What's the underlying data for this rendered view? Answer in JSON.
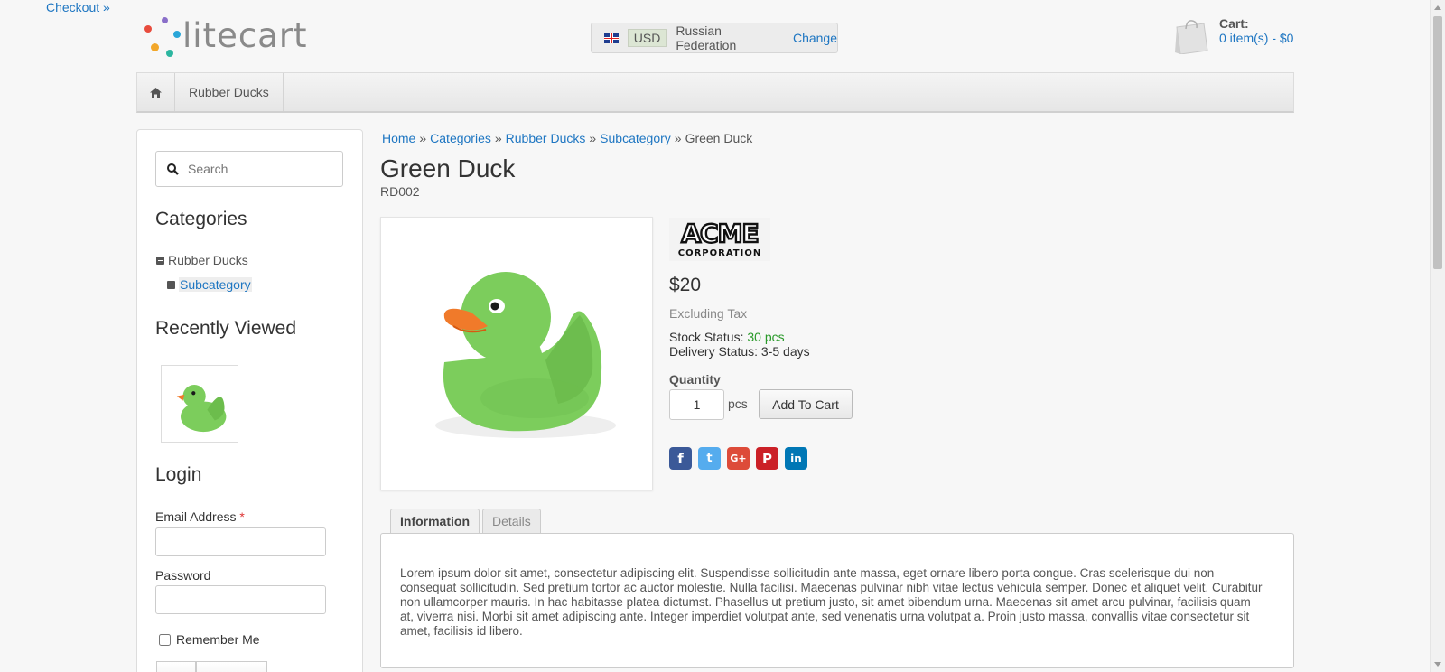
{
  "header": {
    "logo_text": "litecart",
    "region": {
      "currency": "USD",
      "country": "Russian Federation",
      "change_label": "Change"
    },
    "cart": {
      "label": "Cart:",
      "summary": "0 item(s) - $0",
      "checkout_label": "Checkout »"
    }
  },
  "navbar": {
    "home_icon": "home-icon",
    "items": [
      "Rubber Ducks"
    ]
  },
  "sidebar": {
    "search_placeholder": "Search",
    "categories_heading": "Categories",
    "categories": [
      {
        "label": "Rubber Ducks"
      },
      {
        "label": "Subcategory"
      }
    ],
    "recently_viewed_heading": "Recently Viewed",
    "login": {
      "heading": "Login",
      "email_label": "Email Address",
      "required_mark": "*",
      "password_label": "Password",
      "remember_label": "Remember Me"
    }
  },
  "breadcrumb": {
    "items": [
      "Home",
      "Categories",
      "Rubber Ducks",
      "Subcategory"
    ],
    "separator": "»",
    "current": "Green Duck"
  },
  "product": {
    "name": "Green Duck",
    "sku": "RD002",
    "manufacturer_logo_text": "ACME CORPORATION",
    "price": "$20",
    "tax_note": "Excluding Tax",
    "stock_label": "Stock Status:",
    "stock_value": "30 pcs",
    "delivery": "Delivery Status: 3-5 days",
    "quantity_label": "Quantity",
    "quantity_value": "1",
    "unit": "pcs",
    "add_to_cart_label": "Add To Cart",
    "share_icons": [
      "facebook-icon",
      "twitter-icon",
      "google-plus-icon",
      "pinterest-icon",
      "linkedin-icon"
    ]
  },
  "tabs": {
    "items": [
      "Information",
      "Details"
    ],
    "active": "Information",
    "description": "Lorem ipsum dolor sit amet, consectetur adipiscing elit. Suspendisse sollicitudin ante massa, eget ornare libero porta congue. Cras scelerisque dui non consequat sollicitudin. Sed pretium tortor ac auctor molestie. Nulla facilisi. Maecenas pulvinar nibh vitae lectus vehicula semper. Donec et aliquet velit. Curabitur non ullamcorper mauris. In hac habitasse platea dictumst. Phasellus ut pretium justo, sit amet bibendum urna. Maecenas sit amet arcu pulvinar, facilisis quam at, viverra nisi. Morbi sit amet adipiscing ante. Integer imperdiet volutpat ante, sed venenatis urna volutpat a. Proin justo massa, convallis vitae consectetur sit amet, facilisis id libero."
  },
  "colors": {
    "link": "#1e76c2",
    "stock_ok": "#2a9a2a",
    "facebook": "#3b5998",
    "twitter": "#55acee",
    "google_plus": "#dd4b39",
    "pinterest": "#cb2027",
    "linkedin": "#0077b5",
    "duck": "#7ccd5c"
  }
}
